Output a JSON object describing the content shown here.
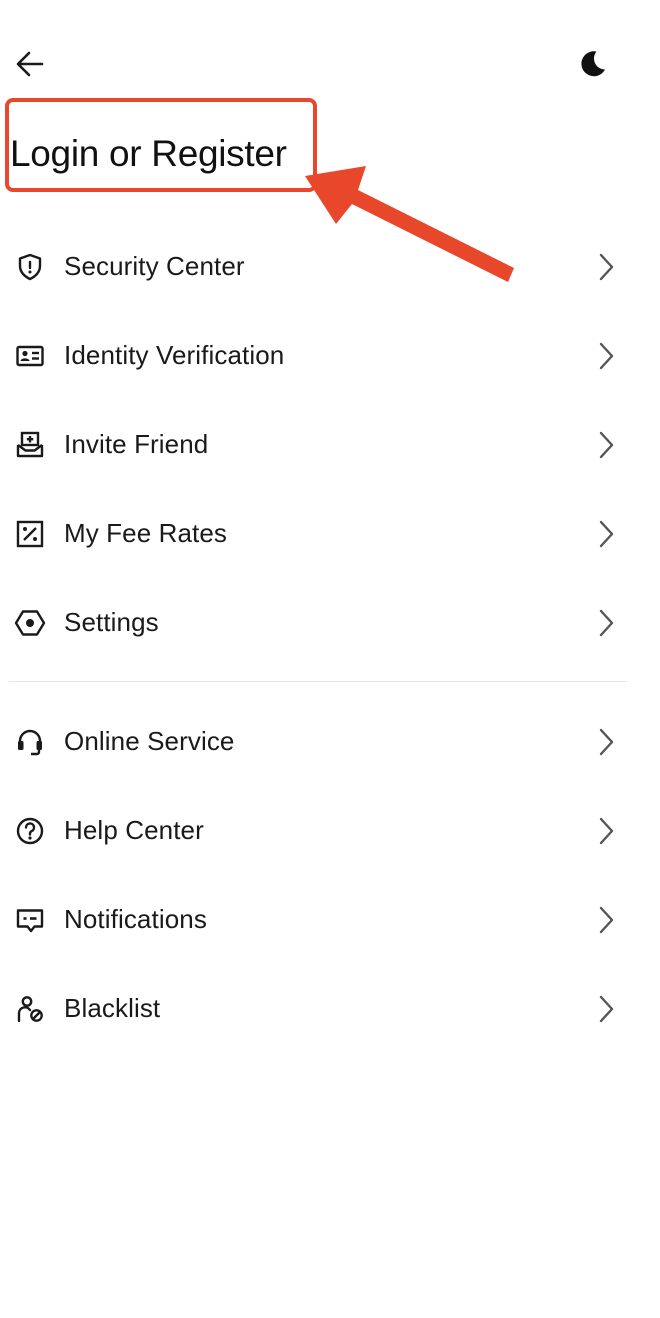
{
  "header": {
    "back_icon": "arrow-left-icon",
    "theme_icon": "moon-icon"
  },
  "login": {
    "label": "Login or Register"
  },
  "annotation": {
    "color": "#e8472c"
  },
  "menu": {
    "group1": [
      {
        "label": "Security Center",
        "icon": "shield-icon"
      },
      {
        "label": "Identity Verification",
        "icon": "id-card-icon"
      },
      {
        "label": "Invite Friend",
        "icon": "invite-inbox-icon"
      },
      {
        "label": "My Fee Rates",
        "icon": "percent-icon"
      },
      {
        "label": "Settings",
        "icon": "gear-icon"
      }
    ],
    "group2": [
      {
        "label": "Online Service",
        "icon": "headset-icon"
      },
      {
        "label": "Help Center",
        "icon": "question-circle-icon"
      },
      {
        "label": "Notifications",
        "icon": "message-icon"
      },
      {
        "label": "Blacklist",
        "icon": "user-blocked-icon"
      }
    ]
  }
}
